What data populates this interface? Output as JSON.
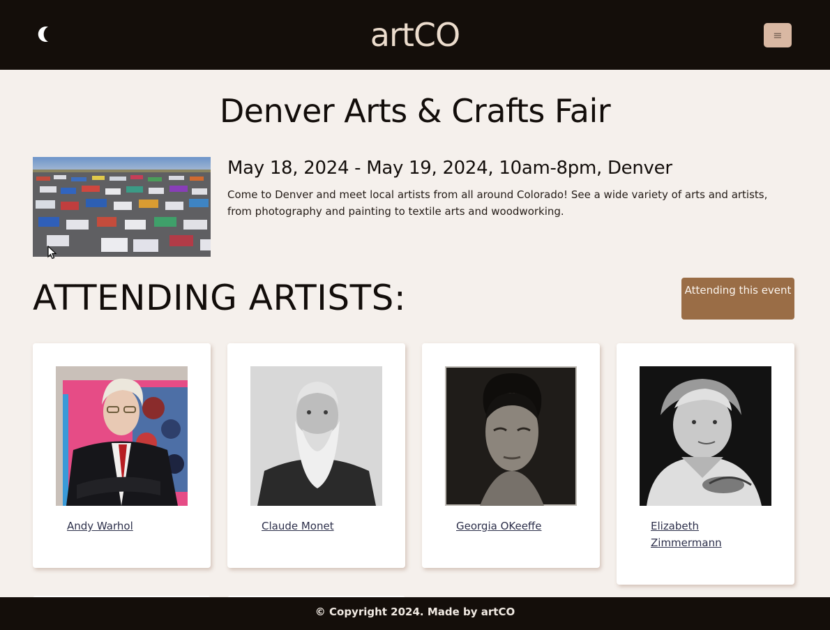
{
  "header": {
    "logo": "artCO",
    "theme_icon": "moon-icon",
    "menu_icon": "hamburger-menu-icon",
    "menu_glyph": "≡"
  },
  "event": {
    "title": "Denver Arts & Crafts Fair",
    "date_line": "May 18, 2024 - May 19, 2024, 10am-8pm, Denver",
    "description": "Come to Denver and meet local artists from all around Colorado! See a wide variety of arts and artists, from photography and painting to textile arts and woodworking."
  },
  "artists_section": {
    "heading": "ATTENDING ARTISTS:",
    "attend_button": "Attending this event",
    "artists": [
      {
        "name": "Andy Warhol"
      },
      {
        "name": "Claude Monet"
      },
      {
        "name": "Georgia OKeeffe"
      },
      {
        "name": "Elizabeth Zimmermann"
      }
    ]
  },
  "footer": {
    "text": "© Copyright 2024. Made by artCO"
  },
  "colors": {
    "header_bg": "#140e0a",
    "page_bg": "#f5f0ec",
    "accent_button": "#9a6d46",
    "menu_button": "#d9b8a3",
    "logo": "#ecdccd"
  }
}
